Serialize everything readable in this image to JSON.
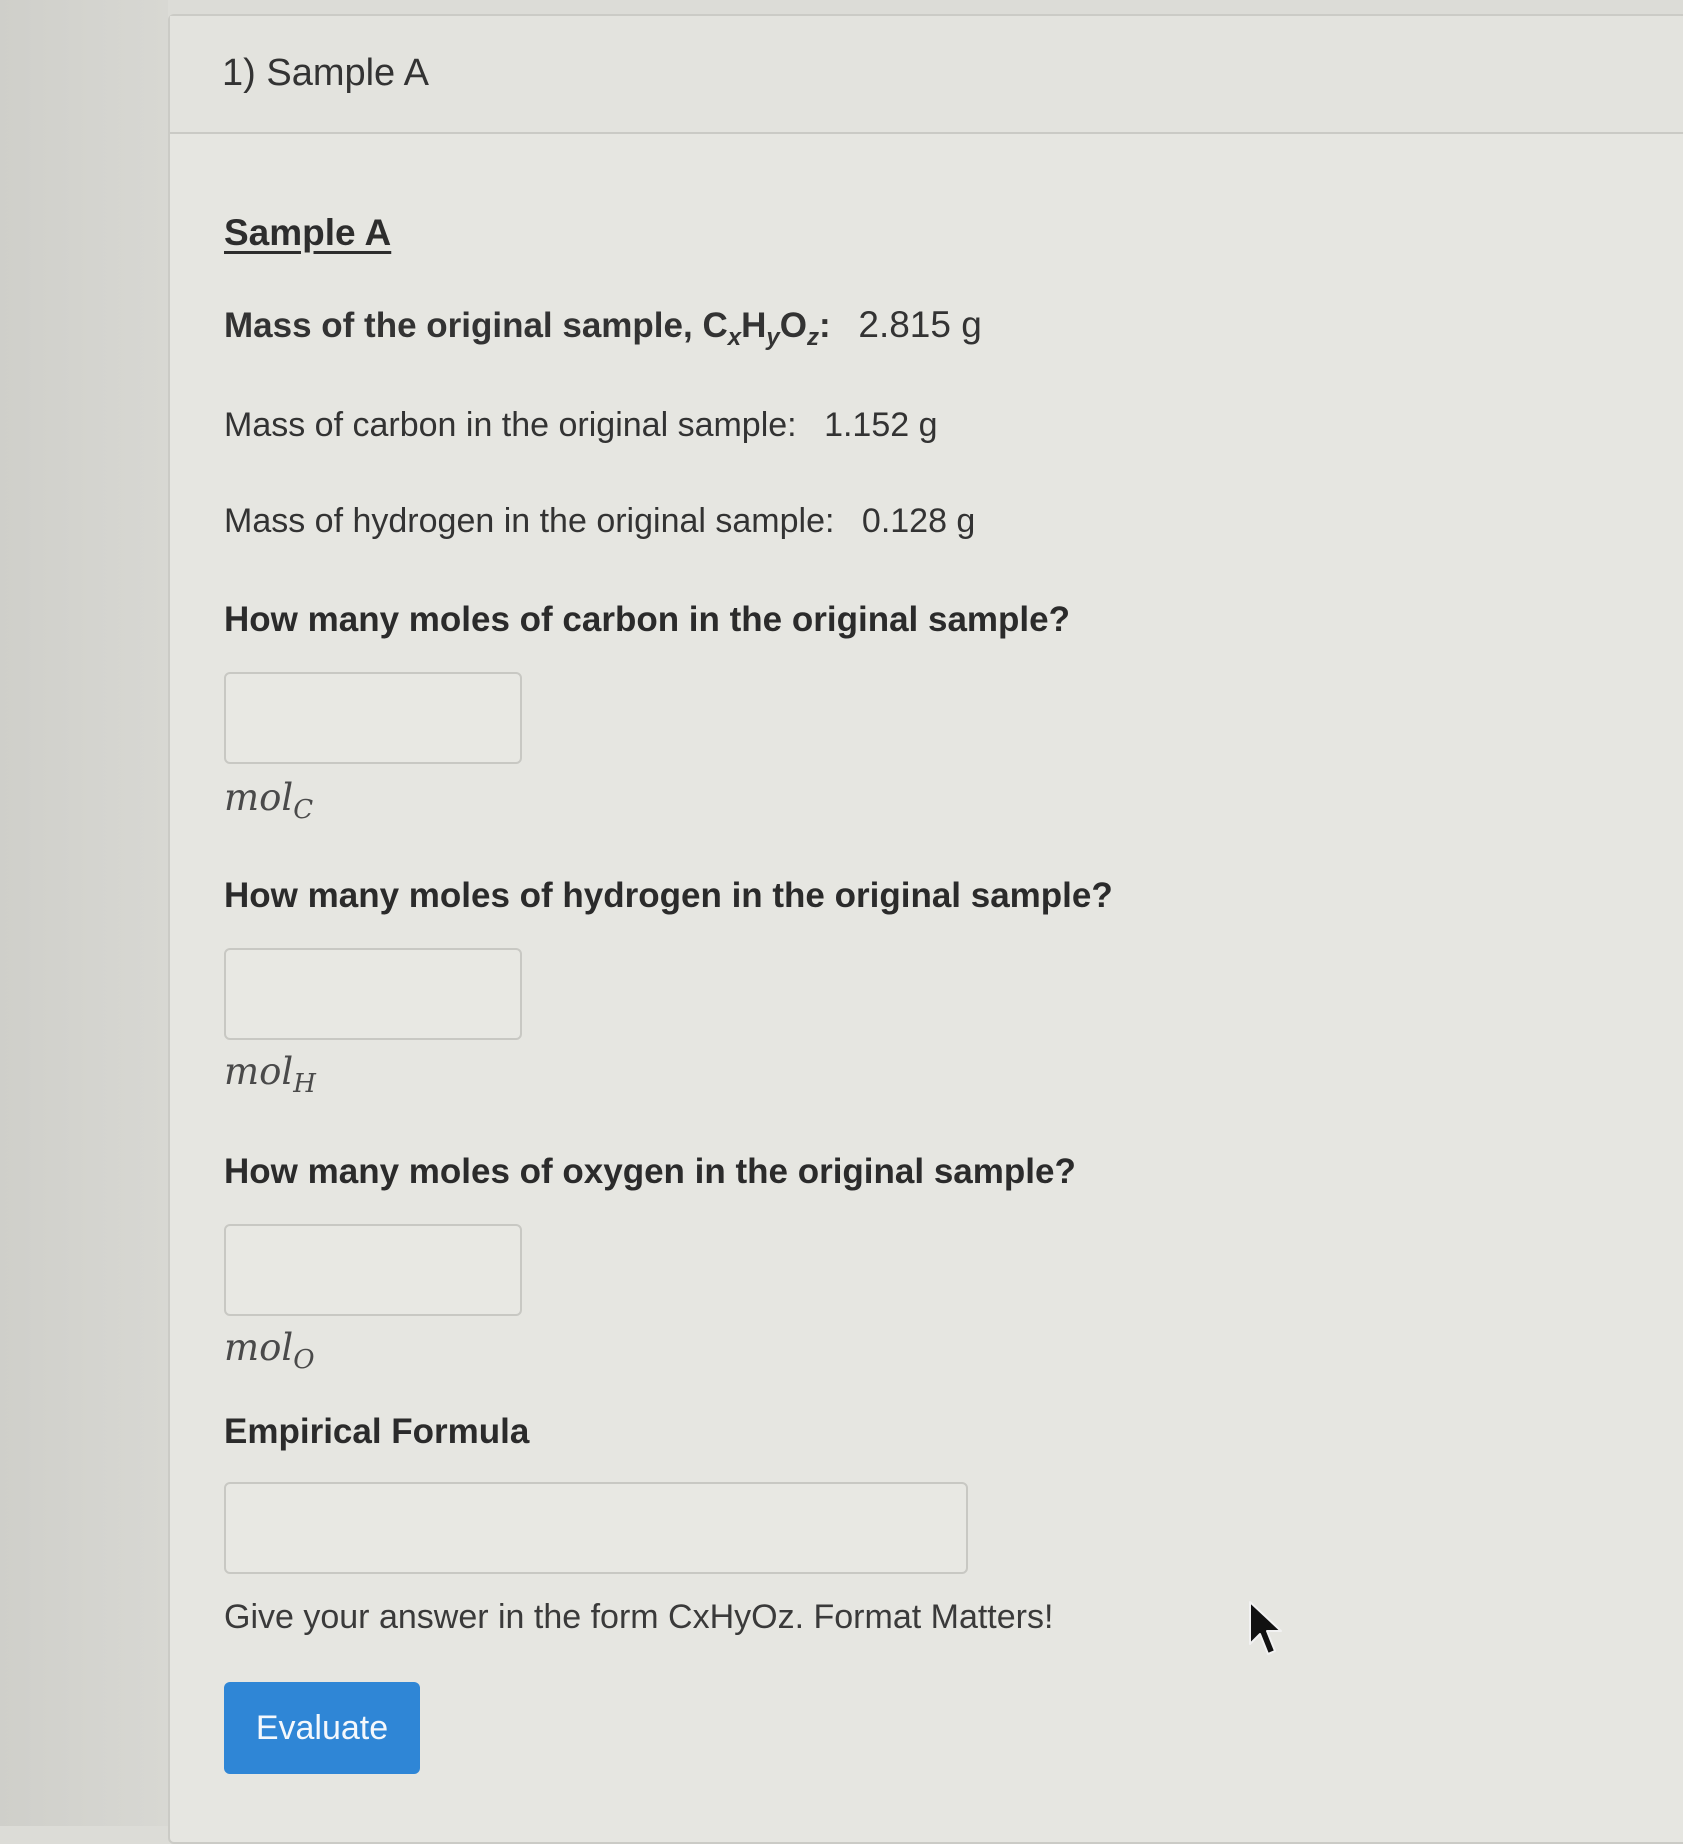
{
  "header": {
    "title": "1) Sample A"
  },
  "section": {
    "title": "Sample A"
  },
  "facts": {
    "original_sample": {
      "label": "Mass of the original sample,",
      "formula_c": "C",
      "formula_x": "x",
      "formula_h": "H",
      "formula_y": "y",
      "formula_o": "O",
      "formula_z": "z",
      "colon": ":",
      "value": "2.815 g"
    },
    "carbon": {
      "label": "Mass of carbon in the original sample:",
      "value": "1.152 g"
    },
    "hydrogen": {
      "label": "Mass of hydrogen in the original sample:",
      "value": "0.128 g"
    }
  },
  "questions": [
    {
      "text": "How many moles of carbon in the original sample?",
      "value": "",
      "unit_base": "mol",
      "unit_sub": "C"
    },
    {
      "text": "How many moles of hydrogen in the original sample?",
      "value": "",
      "unit_base": "mol",
      "unit_sub": "H"
    },
    {
      "text": "How many moles of oxygen in the original sample?",
      "value": "",
      "unit_base": "mol",
      "unit_sub": "O"
    }
  ],
  "empirical": {
    "title": "Empirical Formula",
    "value": "",
    "hint": "Give your answer in the form CxHyOz. Format Matters!"
  },
  "actions": {
    "evaluate_label": "Evaluate"
  }
}
